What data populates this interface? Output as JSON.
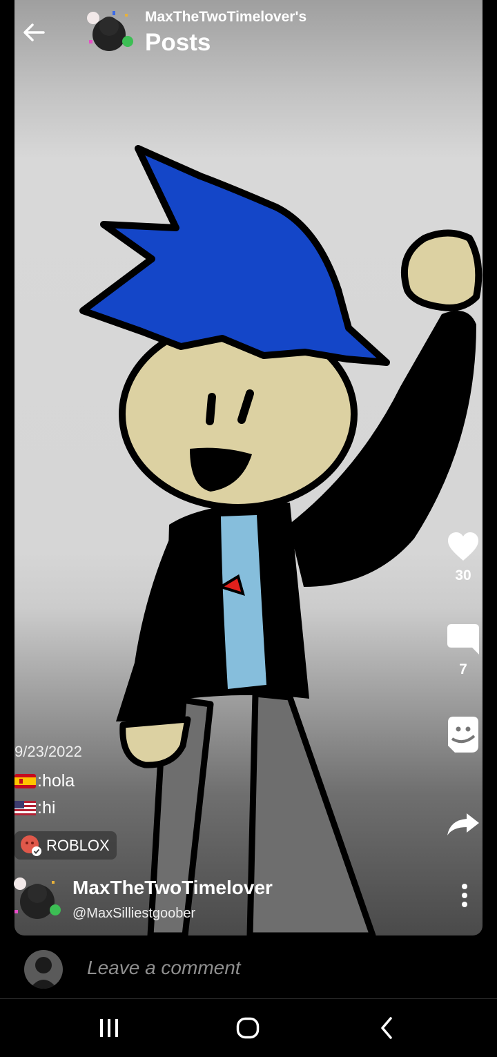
{
  "header": {
    "subtitle": "MaxTheTwoTimelover's",
    "title": "Posts"
  },
  "actions": {
    "likes": "30",
    "comments": "7"
  },
  "caption": {
    "date": "9/23/2022",
    "line1_text": ":hola",
    "line2_text": ":hi",
    "line1_flag": "spain-flag-icon",
    "line2_flag": "usa-flag-icon"
  },
  "tag": {
    "label": "ROBLOX",
    "icon": "roblox-community-icon"
  },
  "author": {
    "name": "MaxTheTwoTimelover",
    "handle": "@MaxSilliestgoober"
  },
  "comment_bar": {
    "placeholder": "Leave a comment"
  },
  "colors": {
    "hair": "#1446c8",
    "skin": "#dcd1a2",
    "shirt": "#86bedc",
    "jacket": "#000000",
    "pants": "#6e6e6e",
    "tag_badge": "#e0584a"
  }
}
